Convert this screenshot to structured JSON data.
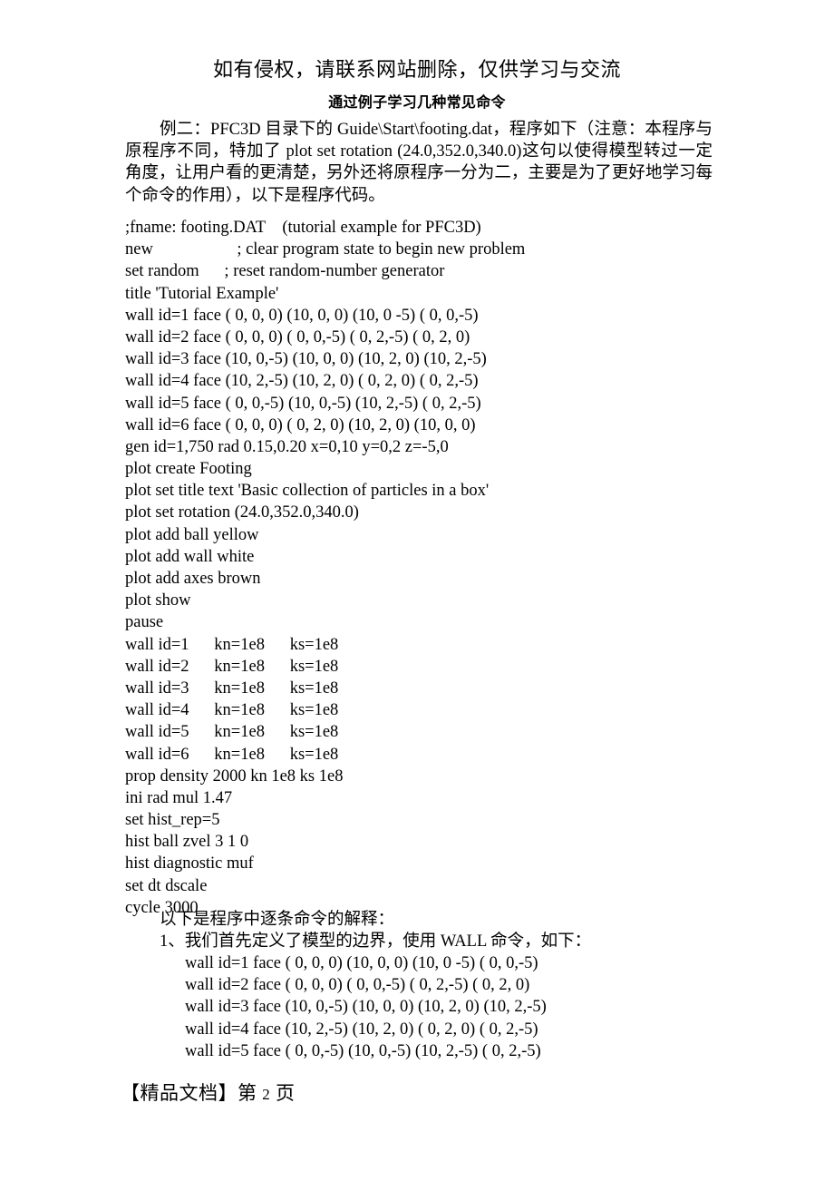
{
  "banner": {
    "text": "如有侵权，请联系网站删除，仅供学习与交流"
  },
  "document": {
    "title": "通过例子学习几种常见命令",
    "intro": "例二：PFC3D 目录下的 Guide\\Start\\footing.dat，程序如下（注意：本程序与原程序不同，特加了 plot set rotation (24.0,352.0,340.0)这句以使得模型转过一定角度，让用户看的更清楚，另外还将原程序一分为二，主要是为了更好地学习每个命令的作用），以下是程序代码。"
  },
  "code": {
    "lines": [
      ";fname: footing.DAT    (tutorial example for PFC3D)",
      "new                    ; clear program state to begin new problem",
      "set random      ; reset random-number generator",
      "title 'Tutorial Example'",
      "wall id=1 face ( 0, 0, 0) (10, 0, 0) (10, 0 -5) ( 0, 0,-5)",
      "wall id=2 face ( 0, 0, 0) ( 0, 0,-5) ( 0, 2,-5) ( 0, 2, 0)",
      "wall id=3 face (10, 0,-5) (10, 0, 0) (10, 2, 0) (10, 2,-5)",
      "wall id=4 face (10, 2,-5) (10, 2, 0) ( 0, 2, 0) ( 0, 2,-5)",
      "wall id=5 face ( 0, 0,-5) (10, 0,-5) (10, 2,-5) ( 0, 2,-5)",
      "wall id=6 face ( 0, 0, 0) ( 0, 2, 0) (10, 2, 0) (10, 0, 0)",
      "gen id=1,750 rad 0.15,0.20 x=0,10 y=0,2 z=-5,0",
      "plot create Footing",
      "plot set title text 'Basic collection of particles in a box'",
      "plot set rotation (24.0,352.0,340.0)",
      "plot add ball yellow",
      "plot add wall white",
      "plot add axes brown",
      "plot show",
      "pause",
      "wall id=1      kn=1e8      ks=1e8",
      "wall id=2      kn=1e8      ks=1e8",
      "wall id=3      kn=1e8      ks=1e8",
      "wall id=4      kn=1e8      ks=1e8",
      "wall id=5      kn=1e8      ks=1e8",
      "wall id=6      kn=1e8      ks=1e8",
      "prop density 2000 kn 1e8 ks 1e8",
      "ini rad mul 1.47",
      "set hist_rep=5",
      "hist ball zvel 3 1 0",
      "hist diagnostic muf",
      "set dt dscale",
      "cycle 3000"
    ]
  },
  "explanation": {
    "lead": "以下是程序中逐条命令的解释：",
    "item1": "1、我们首先定义了模型的边界，使用 WALL 命令，如下：",
    "sub_code_lines": [
      "wall id=1 face ( 0, 0, 0) (10, 0, 0) (10, 0 -5) ( 0, 0,-5)",
      "wall id=2 face ( 0, 0, 0) ( 0, 0,-5) ( 0, 2,-5) ( 0, 2, 0)",
      "wall id=3 face (10, 0,-5) (10, 0, 0) (10, 2, 0) (10, 2,-5)",
      "wall id=4 face (10, 2,-5) (10, 2, 0) ( 0, 2, 0) ( 0, 2,-5)",
      "wall id=5 face ( 0, 0,-5) (10, 0,-5) (10, 2,-5) ( 0, 2,-5)"
    ]
  },
  "footer": {
    "label": "【精品文档】第",
    "page_number": "2",
    "page_unit": "页"
  }
}
